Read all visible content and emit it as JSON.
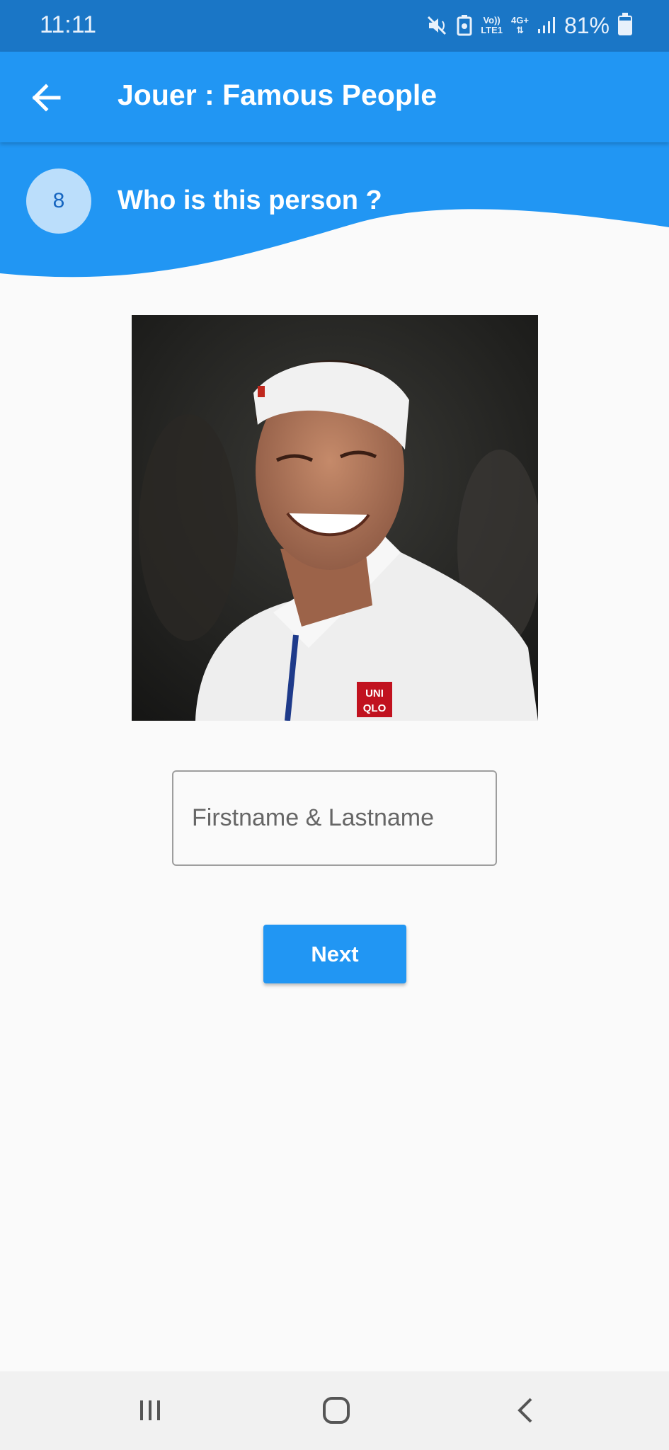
{
  "status_bar": {
    "time": "11:11",
    "volte": "Vo))",
    "lte": "LTE1",
    "network": "4G+",
    "battery": "81%",
    "battery_level": 0.81
  },
  "app_bar": {
    "title": "Jouer : Famous People",
    "back_icon": "arrow-left-icon"
  },
  "question": {
    "number": "8",
    "text": "Who is this person ?"
  },
  "answer_input": {
    "value": "",
    "placeholder": "Firstname & Lastname"
  },
  "next_button": {
    "label": "Next"
  },
  "photo_logo": {
    "line1": "UNI",
    "line2": "QLO"
  },
  "nav_bar": {
    "recents_icon": "recents-icon",
    "home_icon": "home-icon",
    "back_icon": "chevron-left-icon"
  },
  "colors": {
    "primary": "#2196f3",
    "status_bar": "#1a76c6",
    "badge_bg": "#bbdefb",
    "badge_text": "#1565c0",
    "background": "#fafafa"
  }
}
